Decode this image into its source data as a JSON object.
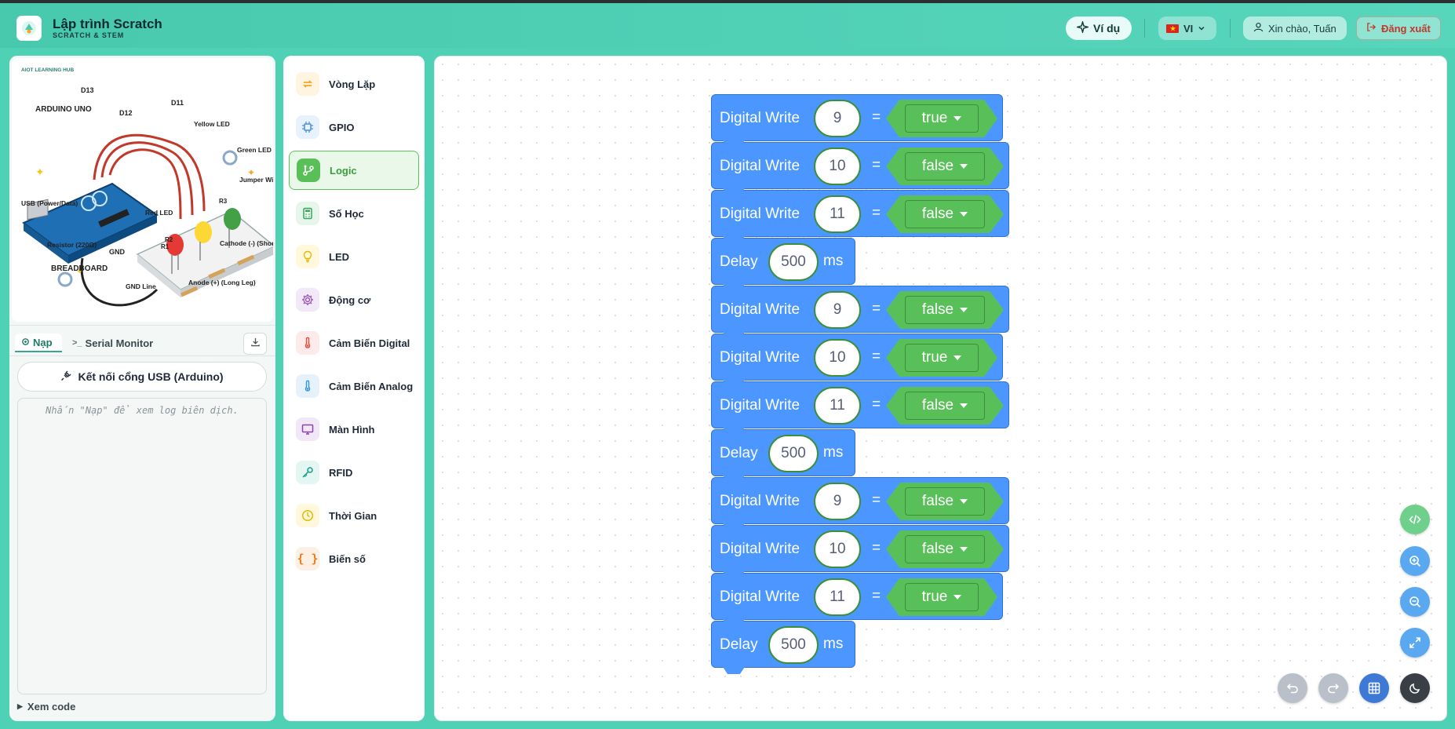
{
  "header": {
    "title": "Lập trình Scratch",
    "subtitle": "SCRATCH & STEM",
    "examples_label": "Ví dụ",
    "lang_label": "VI",
    "greeting": "Xin chào, Tuấn",
    "logout_label": "Đăng xuất"
  },
  "illustration": {
    "brand": "AIOT LEARNING HUB",
    "labels": {
      "board": "ARDUINO UNO",
      "d13": "D13",
      "d12": "D12",
      "d11": "D11",
      "yellow_led": "Yellow LED",
      "green_led": "Green LED",
      "jumper": "Jumper Wires",
      "usb": "USB (Power/Data)",
      "red_led": "Red LED",
      "r1": "R1",
      "r2": "R2",
      "r3": "R3",
      "resistor": "Resistor (220Ω)",
      "gnd": "GND",
      "breadboard": "BREADBOARD",
      "gnd_line": "GND Line",
      "cathode": "Cathode (-) (Short Leg)",
      "anode": "Anode (+) (Long Leg)"
    }
  },
  "left_panel": {
    "tab_upload": "Nạp",
    "tab_serial": "Serial Monitor",
    "connect_label": "Kết nối cổng USB (Arduino)",
    "log_placeholder": "Nhấn \"Nạp\" để xem log biên dịch.",
    "view_code": "Xem code"
  },
  "categories": [
    {
      "label": "Vòng Lặp",
      "icon": "loop-icon",
      "color": "#f5a623",
      "bg": "#fff4e0"
    },
    {
      "label": "GPIO",
      "icon": "chip-icon",
      "color": "#4a90d9",
      "bg": "#e8f2fc"
    },
    {
      "label": "Logic",
      "icon": "branch-icon",
      "color": "#ffffff",
      "bg": "#59c059"
    },
    {
      "label": "Số Học",
      "icon": "calculator-icon",
      "color": "#3aa55c",
      "bg": "#e6f6ea"
    },
    {
      "label": "LED",
      "icon": "lightbulb-icon",
      "color": "#e6b800",
      "bg": "#fff8dc"
    },
    {
      "label": "Động cơ",
      "icon": "gear-icon",
      "color": "#9b59b6",
      "bg": "#f3e8f8"
    },
    {
      "label": "Cảm Biến Digital",
      "icon": "thermometer-icon",
      "color": "#e74c3c",
      "bg": "#fdeaea"
    },
    {
      "label": "Cảm Biến Analog",
      "icon": "thermometer-icon",
      "color": "#3498db",
      "bg": "#e6f2fb"
    },
    {
      "label": "Màn Hình",
      "icon": "monitor-icon",
      "color": "#8e44ad",
      "bg": "#f1e7f7"
    },
    {
      "label": "RFID",
      "icon": "key-icon",
      "color": "#16a085",
      "bg": "#e3f6f2"
    },
    {
      "label": "Thời Gian",
      "icon": "clock-icon",
      "color": "#e6b800",
      "bg": "#fff8dc"
    },
    {
      "label": "Biến số",
      "icon": "braces-icon",
      "color": "#e67e22",
      "bg": "#fdf0e3"
    }
  ],
  "blocks": [
    {
      "type": "write",
      "label": "Digital Write",
      "pin": "9",
      "eq": "=",
      "value": "true"
    },
    {
      "type": "write",
      "label": "Digital Write",
      "pin": "10",
      "eq": "=",
      "value": "false"
    },
    {
      "type": "write",
      "label": "Digital Write",
      "pin": "11",
      "eq": "=",
      "value": "false"
    },
    {
      "type": "delay",
      "label": "Delay",
      "ms_value": "500",
      "unit": "ms"
    },
    {
      "type": "write",
      "label": "Digital Write",
      "pin": "9",
      "eq": "=",
      "value": "false"
    },
    {
      "type": "write",
      "label": "Digital Write",
      "pin": "10",
      "eq": "=",
      "value": "true"
    },
    {
      "type": "write",
      "label": "Digital Write",
      "pin": "11",
      "eq": "=",
      "value": "false"
    },
    {
      "type": "delay",
      "label": "Delay",
      "ms_value": "500",
      "unit": "ms"
    },
    {
      "type": "write",
      "label": "Digital Write",
      "pin": "9",
      "eq": "=",
      "value": "false"
    },
    {
      "type": "write",
      "label": "Digital Write",
      "pin": "10",
      "eq": "=",
      "value": "false"
    },
    {
      "type": "write",
      "label": "Digital Write",
      "pin": "11",
      "eq": "=",
      "value": "true"
    },
    {
      "type": "delay",
      "label": "Delay",
      "ms_value": "500",
      "unit": "ms"
    }
  ],
  "workspace_controls": [
    {
      "name": "code-view-button",
      "icon": "code-icon",
      "bg": "#6fd08c"
    },
    {
      "name": "zoom-in-button",
      "icon": "zoom-in-icon",
      "bg": "#5aa9f0"
    },
    {
      "name": "zoom-out-button",
      "icon": "zoom-out-icon",
      "bg": "#5aa9f0"
    },
    {
      "name": "fit-screen-button",
      "icon": "expand-icon",
      "bg": "#5aa9f0"
    },
    {
      "name": "undo-button",
      "icon": "undo-icon",
      "bg": "#b9c0c9"
    },
    {
      "name": "redo-button",
      "icon": "redo-icon",
      "bg": "#b9c0c9"
    },
    {
      "name": "grid-toggle-button",
      "icon": "grid-icon",
      "bg": "#3f79d6"
    },
    {
      "name": "theme-toggle-button",
      "icon": "moon-icon",
      "bg": "#3a3f46"
    }
  ]
}
